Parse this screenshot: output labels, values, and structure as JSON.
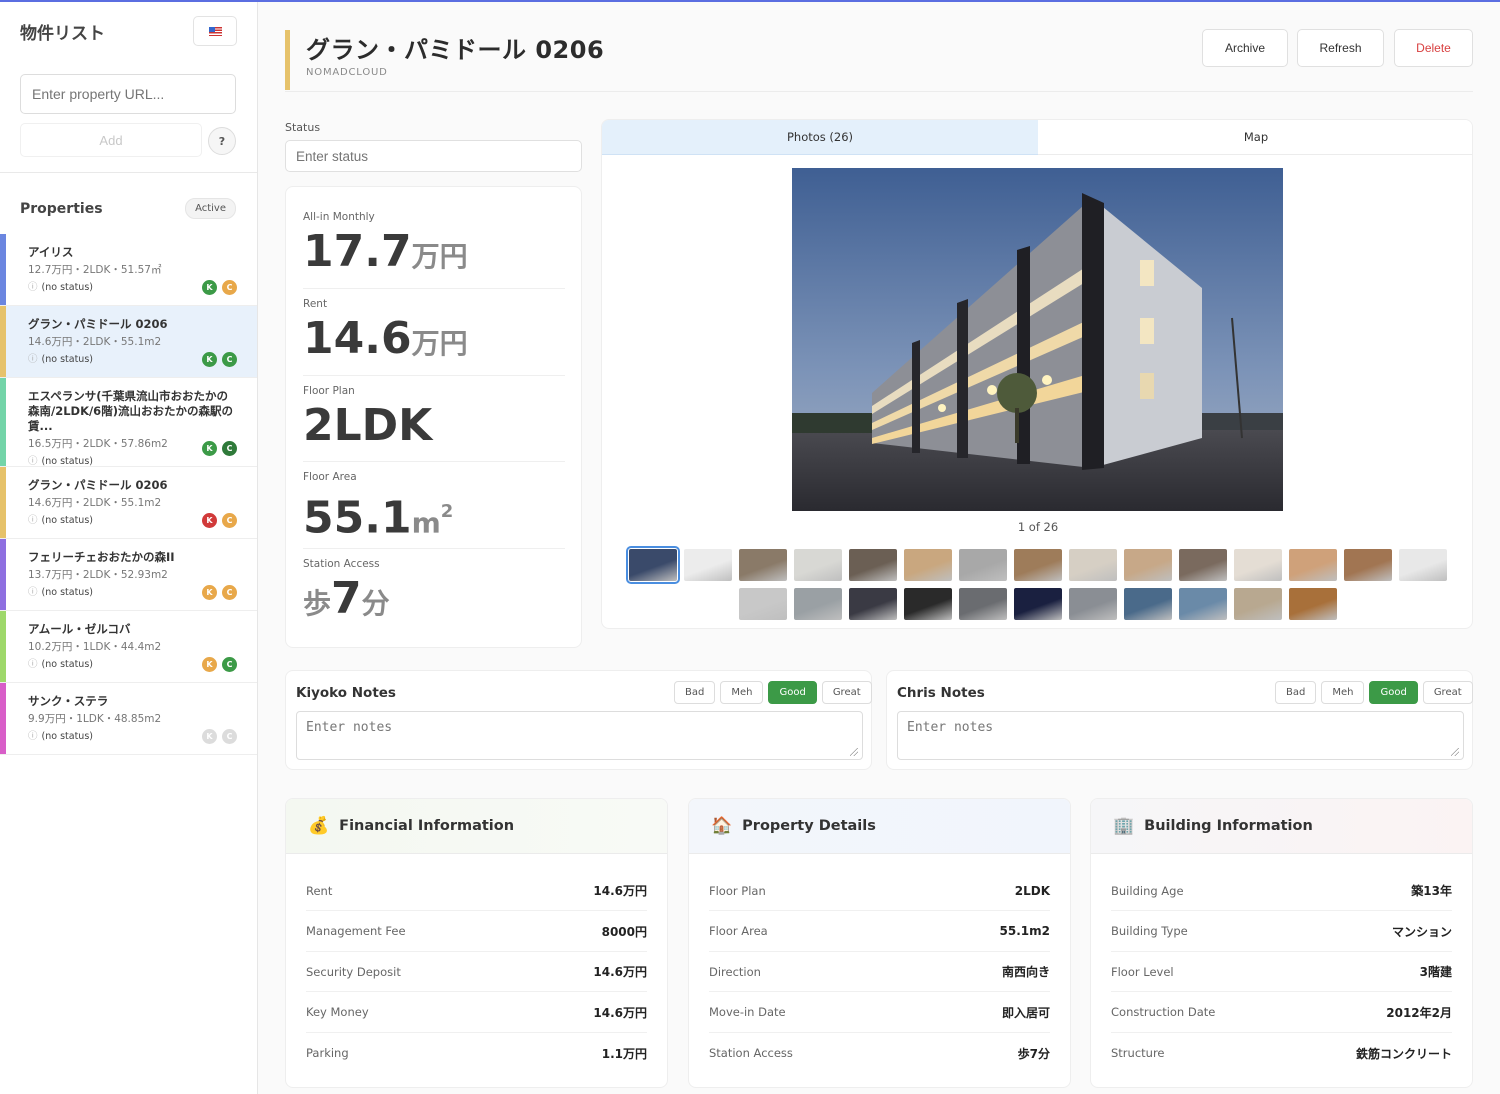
{
  "sidebar": {
    "title": "物件リスト",
    "url_placeholder": "Enter property URL...",
    "add_label": "Add",
    "help_label": "?",
    "properties_title": "Properties",
    "filter_badge": "Active",
    "items": [
      {
        "name": "アイリス",
        "meta": "12.7万円・2LDK・51.57㎡",
        "status": "(no status)",
        "color": "#6b86e0",
        "k": {
          "label": "K",
          "color": "#3c9a47"
        },
        "c": {
          "label": "C",
          "color": "#e8a84a"
        }
      },
      {
        "name": "グラン・パミドール 0206",
        "meta": "14.6万円・2LDK・55.1m2",
        "status": "(no status)",
        "color": "#e6c26a",
        "k": {
          "label": "K",
          "color": "#3c9a47"
        },
        "c": {
          "label": "C",
          "color": "#3c9a47"
        }
      },
      {
        "name": "エスペランサ(千葉県流山市おおたかの森南/2LDK/6階)流山おおたかの森駅の賃...",
        "meta": "16.5万円・2LDK・57.86m2",
        "status": "(no status)",
        "color": "#73d4a8",
        "k": {
          "label": "K",
          "color": "#3c9a47"
        },
        "c": {
          "label": "C",
          "color": "#2f7a3a"
        }
      },
      {
        "name": "グラン・パミドール 0206",
        "meta": "14.6万円・2LDK・55.1m2",
        "status": "(no status)",
        "color": "#e6c26a",
        "k": {
          "label": "K",
          "color": "#d13a3a"
        },
        "c": {
          "label": "C",
          "color": "#e8a84a"
        }
      },
      {
        "name": "フェリーチェおおたかの森II",
        "meta": "13.7万円・2LDK・52.93m2",
        "status": "(no status)",
        "color": "#8e6fe0",
        "k": {
          "label": "K",
          "color": "#e8a84a"
        },
        "c": {
          "label": "C",
          "color": "#e8a84a"
        }
      },
      {
        "name": "アムール・ゼルコバ",
        "meta": "10.2万円・1LDK・44.4m2",
        "status": "(no status)",
        "color": "#9ed86a",
        "k": {
          "label": "K",
          "color": "#e8a84a"
        },
        "c": {
          "label": "C",
          "color": "#3c9a47"
        }
      },
      {
        "name": "サンク・ステラ",
        "meta": "9.9万円・1LDK・48.85m2",
        "status": "(no status)",
        "color": "#d85ec8",
        "k": {
          "label": "K",
          "color": "#dcdcdc"
        },
        "c": {
          "label": "C",
          "color": "#dcdcdc"
        }
      }
    ]
  },
  "header": {
    "title": "グラン・パミドール 0206",
    "subtitle": "NOMADCLOUD",
    "archive_label": "Archive",
    "refresh_label": "Refresh",
    "delete_label": "Delete"
  },
  "status": {
    "label": "Status",
    "placeholder": "Enter status"
  },
  "stats": {
    "all_in": {
      "label": "All-in Monthly",
      "value": "17.7",
      "unit": "万円"
    },
    "rent": {
      "label": "Rent",
      "value": "14.6",
      "unit": "万円"
    },
    "floor_plan": {
      "label": "Floor Plan",
      "value": "2LDK"
    },
    "floor_area": {
      "label": "Floor Area",
      "value": "55.1",
      "unit": "m",
      "sup": "2"
    },
    "station": {
      "label": "Station Access",
      "prefix": "歩",
      "value": "7",
      "unit": "分"
    }
  },
  "photos": {
    "tab_photos": "Photos (26)",
    "tab_map": "Map",
    "counter": "1 of 26",
    "thumb_colors": [
      "#3a4a6a",
      "#ececec",
      "#8a7a68",
      "#d8d8d4",
      "#6b5f54",
      "#c9a77f",
      "#a8a8a8",
      "#9e7c5a",
      "#d6cfc4",
      "#c7a888",
      "#7a6a5e",
      "#e4ddd4",
      "#cfa17a",
      "#a17552",
      "#e8e8e8",
      "#c8c8c8",
      "#9aa0a4",
      "#3a3a44",
      "#2a2a2a",
      "#6a6c70",
      "#1a2040",
      "#8a8e94",
      "#4a6a8a",
      "#6a8aa8",
      "#b8a890",
      "#a8703a"
    ]
  },
  "notes": {
    "kiyoko": {
      "title": "Kiyoko Notes",
      "placeholder": "Enter notes"
    },
    "chris": {
      "title": "Chris Notes",
      "placeholder": "Enter notes"
    },
    "ratings": [
      "Bad",
      "Meh",
      "Good",
      "Great"
    ],
    "selected": "Good"
  },
  "financial": {
    "title": "Financial Information",
    "icon": "money-bag-icon",
    "rows": [
      {
        "k": "Rent",
        "v": "14.6万円"
      },
      {
        "k": "Management Fee",
        "v": "8000円"
      },
      {
        "k": "Security Deposit",
        "v": "14.6万円"
      },
      {
        "k": "Key Money",
        "v": "14.6万円"
      },
      {
        "k": "Parking",
        "v": "1.1万円"
      }
    ]
  },
  "details": {
    "title": "Property Details",
    "icon": "house-icon",
    "rows": [
      {
        "k": "Floor Plan",
        "v": "2LDK"
      },
      {
        "k": "Floor Area",
        "v": "55.1m2"
      },
      {
        "k": "Direction",
        "v": "南西向き"
      },
      {
        "k": "Move-in Date",
        "v": "即入居可"
      },
      {
        "k": "Station Access",
        "v": "歩7分"
      }
    ]
  },
  "building": {
    "title": "Building Information",
    "icon": "office-building-icon",
    "rows": [
      {
        "k": "Building Age",
        "v": "築13年"
      },
      {
        "k": "Building Type",
        "v": "マンション"
      },
      {
        "k": "Floor Level",
        "v": "3階建"
      },
      {
        "k": "Construction Date",
        "v": "2012年2月"
      },
      {
        "k": "Structure",
        "v": "鉄筋コンクリート"
      }
    ]
  }
}
